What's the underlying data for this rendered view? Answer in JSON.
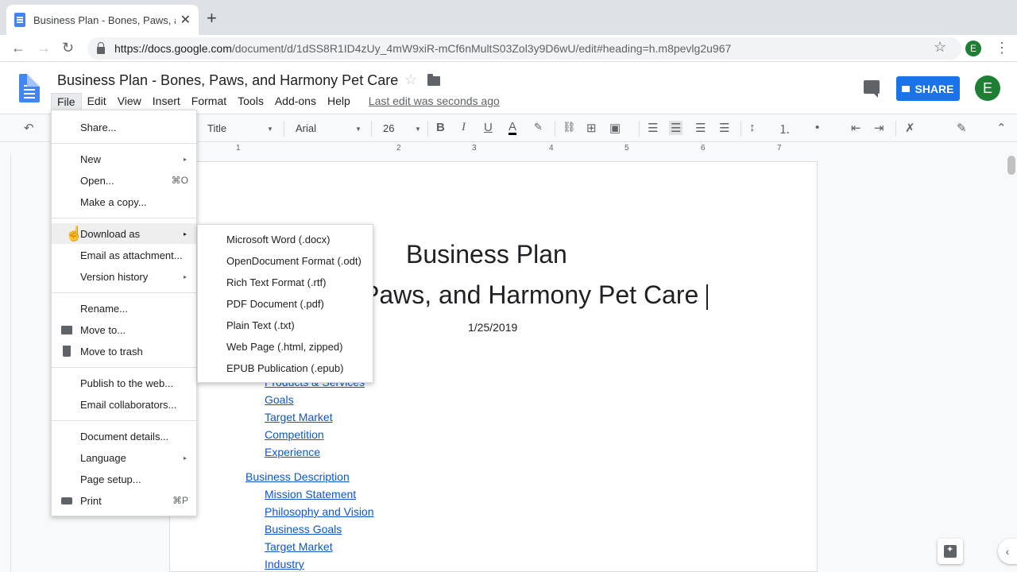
{
  "browser": {
    "tab_title": "Business Plan - Bones, Paws, and",
    "tab_close": "✕",
    "new_tab": "+",
    "url_host": "https://docs.google.com",
    "url_path": "/document/d/1dSS8R1ID4zUy_4mW9xiR-mCf6nMultS03Zol3y9D6wU/edit#heading=h.m8pevlg2u967",
    "avatar_letter": "E"
  },
  "docs": {
    "title": "Business Plan - Bones, Paws, and Harmony Pet Care",
    "menus": [
      "File",
      "Edit",
      "View",
      "Insert",
      "Format",
      "Tools",
      "Add-ons",
      "Help"
    ],
    "last_edit": "Last edit was seconds ago",
    "share_label": "SHARE",
    "avatar_letter": "E"
  },
  "toolbar": {
    "style": "Title",
    "font": "Arial",
    "size": "26"
  },
  "ruler": [
    "1",
    "2",
    "3",
    "4",
    "5",
    "6",
    "7"
  ],
  "document": {
    "heading1": "Business Plan",
    "heading2": "Paws, and Harmony Pet Care",
    "date": "1/25/2019",
    "toc_partial": "Products & Services",
    "toc": [
      "Goals",
      "Target Market",
      "Competition",
      "Experience",
      "Business Description",
      "Mission Statement",
      "Philosophy and Vision",
      "Business Goals",
      "Target Market",
      "Industry"
    ]
  },
  "file_menu": {
    "items": [
      {
        "label": "Share..."
      },
      {
        "label": "New"
      },
      {
        "label": "Open...",
        "shortcut": "⌘O"
      },
      {
        "label": "Make a copy..."
      },
      {
        "label": "Download as"
      },
      {
        "label": "Email as attachment..."
      },
      {
        "label": "Version history"
      },
      {
        "label": "Rename..."
      },
      {
        "label": "Move to..."
      },
      {
        "label": "Move to trash"
      },
      {
        "label": "Publish to the web..."
      },
      {
        "label": "Email collaborators..."
      },
      {
        "label": "Document details..."
      },
      {
        "label": "Language"
      },
      {
        "label": "Page setup..."
      },
      {
        "label": "Print",
        "shortcut": "⌘P"
      }
    ]
  },
  "download_menu": {
    "items": [
      "Microsoft Word (.docx)",
      "OpenDocument Format (.odt)",
      "Rich Text Format (.rtf)",
      "PDF Document (.pdf)",
      "Plain Text (.txt)",
      "Web Page (.html, zipped)",
      "EPUB Publication (.epub)"
    ]
  },
  "icons": {
    "back": "←",
    "forward": "→",
    "reload": "↻",
    "star": "☆",
    "kebab": "⋮",
    "undo": "↶",
    "bold": "B",
    "italic": "I",
    "underline": "U",
    "text_color": "A",
    "link": "🔗",
    "comment": "⊞",
    "image": "▣",
    "chevron_up": "⌃",
    "chevron_left": "‹",
    "submenu_arrow": "▸",
    "hand": "☝"
  },
  "colors": {
    "accent": "#1a73e8",
    "link": "#1155cc",
    "avatar": "#1e7e34"
  }
}
